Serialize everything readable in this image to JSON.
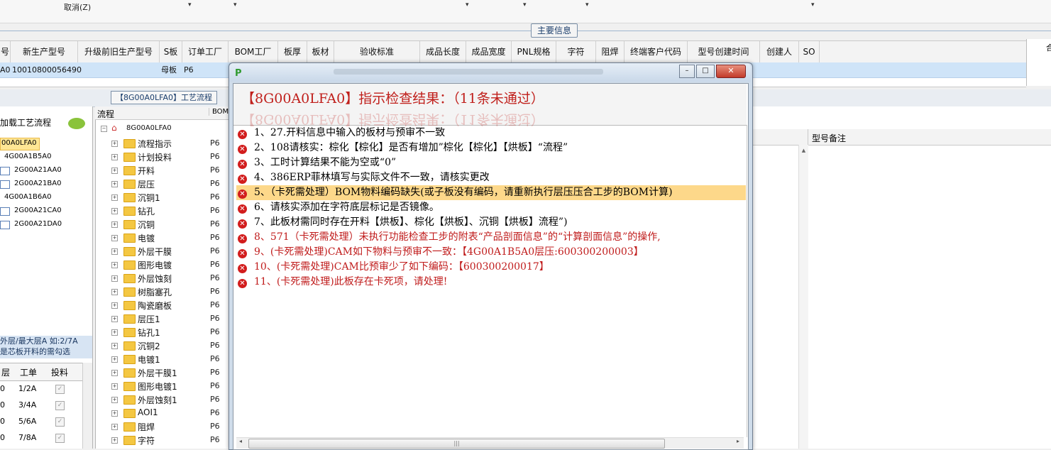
{
  "toolbar": {
    "cancel_label": "取消(Z)"
  },
  "main_info_tab": "主要信息",
  "grid": {
    "columns": [
      "号",
      "新生产型号",
      "升级前旧生产型号",
      "S板",
      "订单工厂",
      "BOM工厂",
      "板厚",
      "板材",
      "验收标准",
      "成品长度",
      "成品宽度",
      "PNL规格",
      "字符",
      "阻焊",
      "终端客户代码",
      "型号创建时间",
      "创建人",
      "SO"
    ],
    "row": {
      "c0": "A0",
      "c1": "10010800056490",
      "c3": "母板",
      "c4": "P6"
    },
    "right_label": "合"
  },
  "process_tab": "【8G00A0LFA0】工艺流程",
  "left_panel": {
    "title": "加载工艺流程",
    "items": [
      "00A0LFA0",
      "4G00A1B5A0",
      "2G00A21AA0",
      "2G00A21BA0",
      "4G00A1B6A0",
      "2G00A21CA0",
      "2G00A21DA0"
    ],
    "hint_line1": "外层/最大层A 如:2/7A",
    "hint_line2": "是芯板开料的需勾选",
    "table_headers": [
      "层",
      "工单",
      "投料"
    ],
    "rows": [
      {
        "a": "0",
        "b": "1/2A"
      },
      {
        "a": "0",
        "b": "3/4A"
      },
      {
        "a": "0",
        "b": "5/6A"
      },
      {
        "a": "0",
        "b": "7/8A"
      }
    ]
  },
  "tree": {
    "header_flow": "流程",
    "header_bom": "BOM",
    "root": "8G00A0LFA0",
    "nodes": [
      "流程指示",
      "计划投料",
      "开料",
      "层压",
      "沉铜1",
      "钻孔",
      "沉铜",
      "电镀",
      "外层干膜",
      "图形电镀",
      "外层蚀刻",
      "树脂塞孔",
      "陶瓷磨板",
      "层压1",
      "钻孔1",
      "沉铜2",
      "电镀1",
      "外层干膜1",
      "图形电镀1",
      "外层蚀刻1",
      "AOI1",
      "阻焊",
      "字符"
    ],
    "bom_value": "P6"
  },
  "right_area": {
    "remark_header": "型号备注"
  },
  "dialog": {
    "title": "【8G00A0LFA0】指示检查结果：（11条未通过）",
    "messages": [
      "1、27.开料信息中输入的板材与预审不一致",
      "2、108请核实：棕化【棕化】是否有增加”棕化【棕化】【烘板】“流程”",
      "3、工时计算结果不能为空或“0”",
      "4、386ERP菲林填写与实际文件不一致，请核实更改",
      "5、（卡死需处理）BOM物料编码缺失(或子板没有编码，请重新执行层压压合工步的BOM计算)",
      "6、请核实添加在字符底层标记是否镜像。",
      "7、此板材需同时存在开料【烘板】、棕化【烘板】、沉铜【烘板】流程”)",
      "8、571（卡死需处理）未执行功能检查工步的附表“产品剖面信息”的“计算剖面信息”的操作,",
      "9、(卡死需处理)CAM如下物料与预审不一致：【4G00A1B5A0层压:600300200003】",
      "10、(卡死需处理)CAM比预审少了如下编码：【600300200017】",
      "11、(卡死需处理)此板存在卡死项，请处理!"
    ],
    "highlight_index": 4,
    "red_from_index": 7
  }
}
